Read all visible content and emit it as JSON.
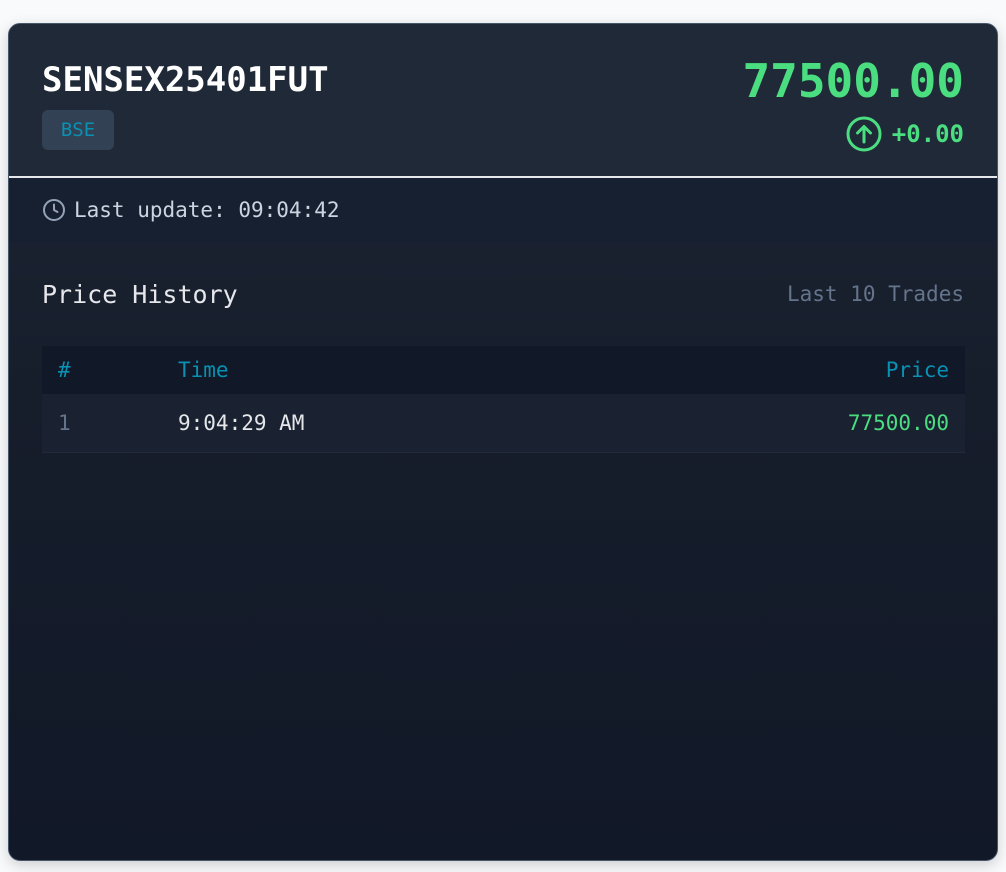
{
  "instrument": {
    "symbol": "SENSEX25401FUT",
    "exchange": "BSE",
    "price": "77500.00",
    "change": "+0.00",
    "change_icon": "arrow-up-circle-icon"
  },
  "status": {
    "last_update_label": "Last update: 09:04:42",
    "icon": "clock-icon"
  },
  "history": {
    "title": "Price History",
    "subtitle": "Last 10 Trades",
    "columns": {
      "index": "#",
      "time": "Time",
      "price": "Price"
    },
    "rows": [
      {
        "index": "1",
        "time": "9:04:29 AM",
        "price": "77500.00"
      }
    ]
  },
  "colors": {
    "accent_up": "#4ade80",
    "accent_cyan": "#0891b2",
    "card_bg": "#1f2937",
    "page_bg": "#f8fafc"
  }
}
